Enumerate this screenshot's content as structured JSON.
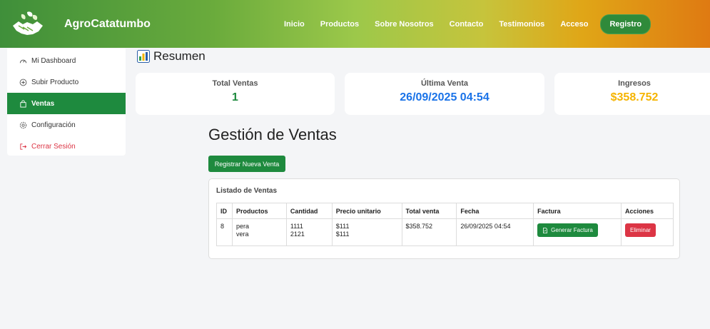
{
  "brand": {
    "name": "AgroCatatumbo"
  },
  "nav": {
    "links": [
      "Inicio",
      "Productos",
      "Sobre Nosotros",
      "Contacto",
      "Testimonios",
      "Acceso"
    ],
    "register": "Registro"
  },
  "sidebar": {
    "items": [
      {
        "label": "Mi Dashboard",
        "icon": "speedometer-icon"
      },
      {
        "label": "Subir Producto",
        "icon": "plus-circle-icon"
      },
      {
        "label": "Ventas",
        "icon": "bag-icon"
      },
      {
        "label": "Configuración",
        "icon": "gear-icon"
      },
      {
        "label": "Cerrar Sesión",
        "icon": "logout-icon"
      }
    ],
    "active_index": 2
  },
  "summary": {
    "title": "Resumen",
    "cards": [
      {
        "label": "Total Ventas",
        "value": "1",
        "color": "#1e8a3e"
      },
      {
        "label": "Última Venta",
        "value": "26/09/2025 04:54",
        "color": "#1a73e8"
      },
      {
        "label": "Ingresos",
        "value": "$358.752",
        "color": "#f5b400"
      }
    ]
  },
  "sales": {
    "heading": "Gestión de Ventas",
    "new_button": "Registrar Nueva Venta",
    "list_title": "Listado de Ventas",
    "columns": [
      "ID",
      "Productos",
      "Cantidad",
      "Precio unitario",
      "Total venta",
      "Fecha",
      "Factura",
      "Acciones"
    ],
    "rows": [
      {
        "id": "8",
        "products": [
          "pera",
          "vera"
        ],
        "quantities": [
          "1111",
          "2121"
        ],
        "unit_prices": [
          "$111",
          "$111"
        ],
        "total": "$358.752",
        "date": "26/09/2025 04:54",
        "invoice_button": "Generar Factura",
        "delete_button": "Eliminar"
      }
    ]
  },
  "colors": {
    "primary_green": "#1e8a3e",
    "danger": "#dc3545",
    "accent_blue": "#1a73e8",
    "accent_gold": "#f5b400"
  }
}
